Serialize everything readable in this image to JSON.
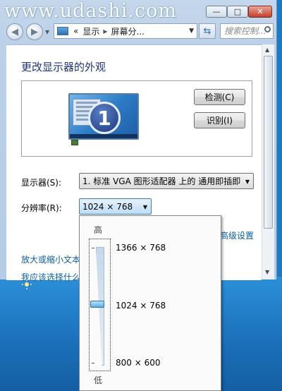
{
  "window": {
    "watermark": "www.udashi.com",
    "controls": {
      "minimize": "—",
      "maximize": "□",
      "close": "✕"
    }
  },
  "nav": {
    "breadcrumb": [
      "显示",
      "屏幕分..."
    ],
    "breadcrumb_prefix": "«",
    "search_placeholder": "搜索控制..."
  },
  "content": {
    "title": "更改显示器的外观",
    "monitor_number": "1",
    "detect_button": "检测(C)",
    "identify_button": "识别(I)",
    "display_label": "显示器(S):",
    "display_value": "1. 标准 VGA 图形适配器 上的 通用即插即",
    "resolution_label": "分辨率(R):",
    "resolution_value": "1024 × 768",
    "advanced_link": "高级设置",
    "zoom_link": "放大或缩小文本",
    "which_link": "我应该选择什么"
  },
  "resolution_popup": {
    "high_label": "高",
    "low_label": "低",
    "options": [
      "1366 × 768",
      "1024 × 768",
      "800 × 600"
    ],
    "selected_index": 1
  },
  "colors": {
    "title": "#1e3287",
    "link": "#0a5ca6",
    "desktop": "#1a7bc6"
  }
}
